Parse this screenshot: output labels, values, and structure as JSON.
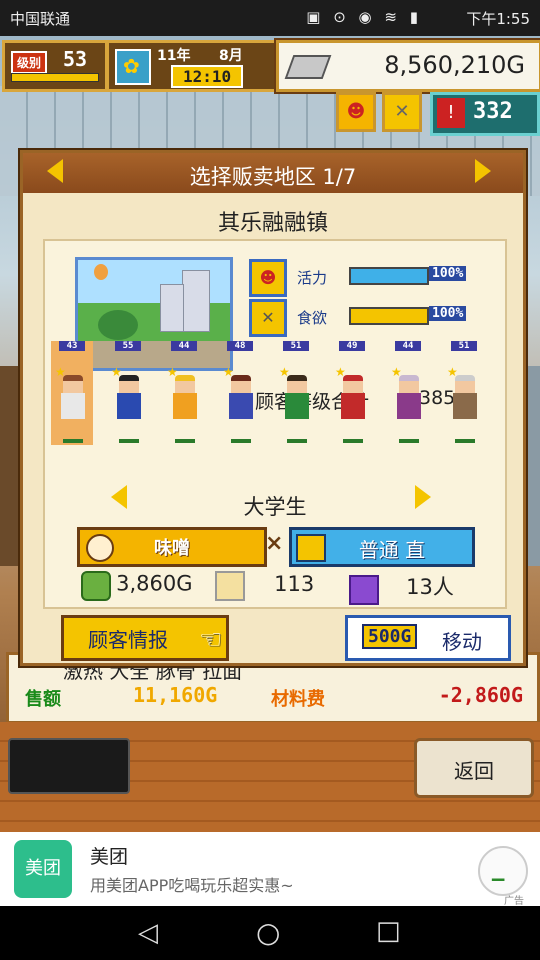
{
  "status_bar": {
    "carrier": "中国联通",
    "time": "下午1:55",
    "icons": "▣ ⊙ ◉ ≋ ▮"
  },
  "hud": {
    "level_tag": "级别",
    "level": "53",
    "year": "11年",
    "month": "8月",
    "time": "12:10",
    "money": "8,560,210G",
    "count": "332"
  },
  "dialog": {
    "title": "选择贩卖地区 1/7",
    "town": "其乐融融镇",
    "stats": [
      {
        "label": "活力",
        "value": "100",
        "unit": "%",
        "fill": 1.0,
        "color": "#3fb0e8"
      },
      {
        "label": "食欲",
        "value": "100",
        "unit": "%",
        "fill": 1.0,
        "color": "#f4c400"
      }
    ],
    "rank_label": "顾客等级合计",
    "rank_value": "385",
    "customers": [
      {
        "lv": "43",
        "torso": "#e8e8e8"
      },
      {
        "lv": "55",
        "torso": "#2a4ab0"
      },
      {
        "lv": "44",
        "torso": "#f0a020"
      },
      {
        "lv": "48",
        "torso": "#3a4ab0"
      },
      {
        "lv": "51",
        "torso": "#2a8a3a"
      },
      {
        "lv": "49",
        "torso": "#c22a2a"
      },
      {
        "lv": "44",
        "torso": "#8a3a8a"
      },
      {
        "lv": "51",
        "torso": "#8a6a4a"
      }
    ],
    "customer_type": "大学生",
    "tag_left": "味噌",
    "tag_right": "普通 直",
    "times": "×",
    "price": "3,860G",
    "spoon_value": "113",
    "people": "13人",
    "customer_info_button": "顾客情报",
    "move_cost": "500G",
    "move_label": "移动"
  },
  "behind": {
    "shop_name": "激热 大全 豚骨 拉面",
    "sales_label": "售额",
    "sales_value": "11,160G",
    "material_label": "材料费",
    "material_value": "-2,860G"
  },
  "back_button": "返回",
  "ad": {
    "logo": "美团",
    "title": "美团",
    "subtitle": "用美团APP吃喝玩乐超实惠~",
    "tag": "广告"
  },
  "nav": {
    "back": "◁",
    "home": "○",
    "recent": "□"
  }
}
